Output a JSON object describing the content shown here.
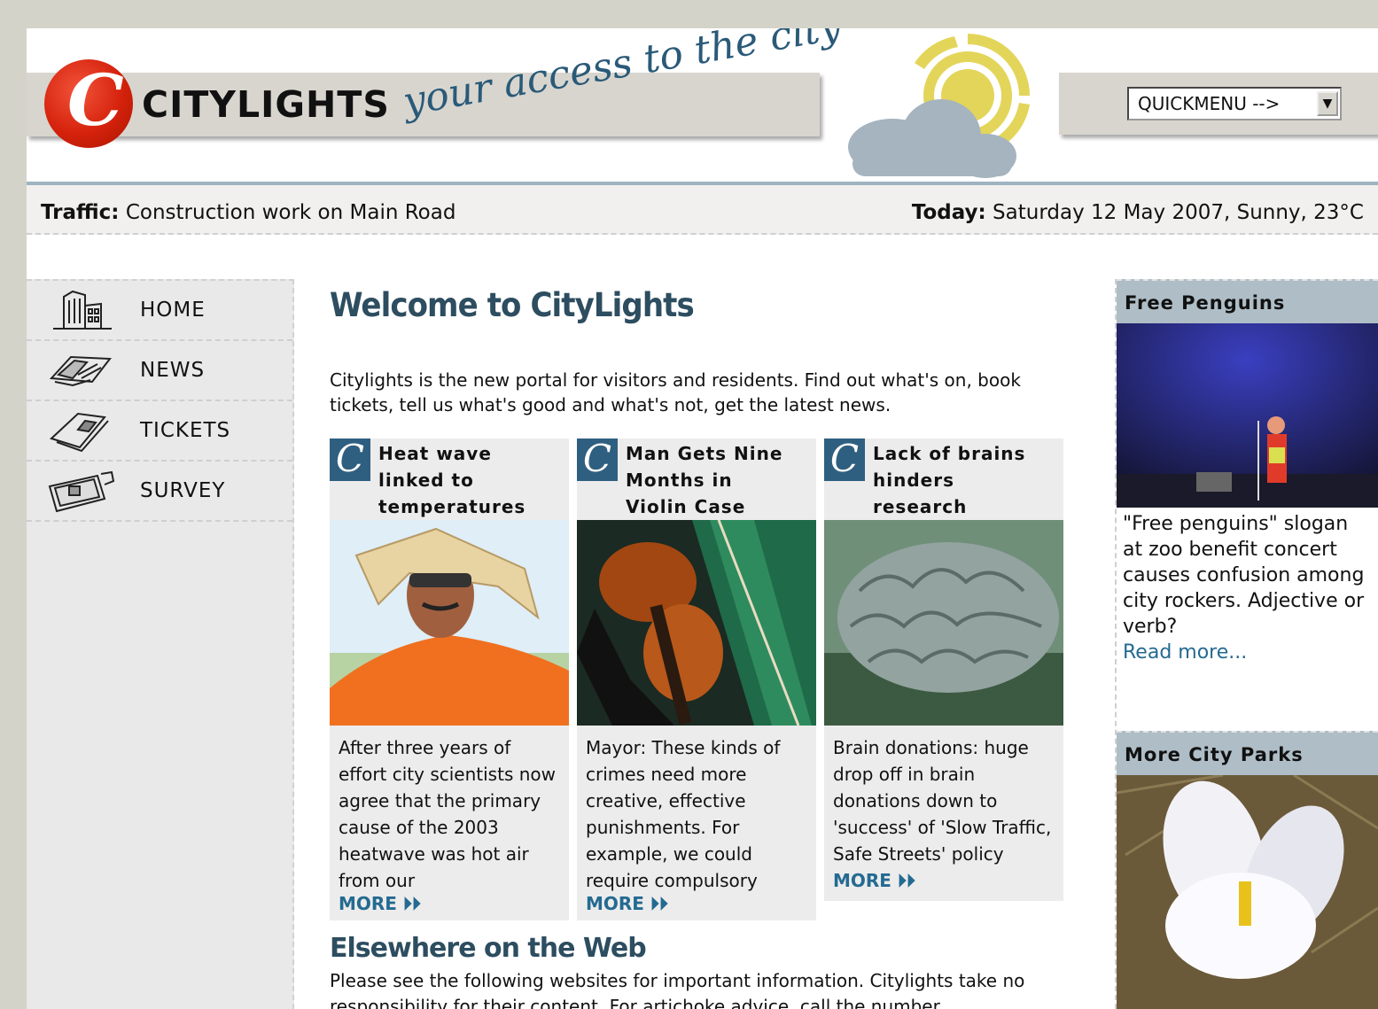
{
  "header": {
    "brand": "CITYLIGHTS",
    "tagline": "your access to the city",
    "quickmenu_value": "QUICKMENU -->",
    "quickmenu_arrow": "▼"
  },
  "info_bar": {
    "traffic_label": "Traffic:",
    "traffic_text": "Construction work on Main Road",
    "today_label": "Today:",
    "today_text": "Saturday 12 May 2007, Sunny, 23°C"
  },
  "nav": {
    "items": [
      {
        "label": "HOME",
        "icon": "building-icon"
      },
      {
        "label": "NEWS",
        "icon": "newspaper-icon"
      },
      {
        "label": "TICKETS",
        "icon": "ticket-icon"
      },
      {
        "label": "SURVEY",
        "icon": "clipboard-icon"
      }
    ]
  },
  "main": {
    "title": "Welcome to CityLights",
    "intro": "Citylights is the new portal for visitors and residents. Find out what's on, book tickets, tell us what's good and what's not, get the latest news.",
    "stories": [
      {
        "title_lines": [
          "Heat wave",
          "linked to",
          "temperatures"
        ],
        "body": "After three years of effort city scientists now agree that the primary cause of the 2003 heatwave was hot air from our",
        "more": "MORE ⏵⏵"
      },
      {
        "title_lines": [
          "Man Gets Nine",
          "Months in",
          "Violin Case"
        ],
        "body": "Mayor: These kinds of crimes need more creative, effective punishments. For example, we could require compulsory",
        "more": "MORE ⏵⏵"
      },
      {
        "title_lines": [
          "Lack of brains",
          "hinders",
          "research"
        ],
        "body": "Brain donations: huge drop off in brain donations down to 'success' of 'Slow Traffic, Safe Streets' policy",
        "more": "MORE ⏵⏵"
      }
    ],
    "elsewhere_title": "Elsewhere on the Web",
    "elsewhere_text": "Please see the following websites for important information. Citylights take no responsibility for their content. For artichoke advice, call the number"
  },
  "right": {
    "box1_title": "Free Penguins",
    "box1_text": "\"Free penguins\" slogan at zoo benefit concert causes confusion among city rockers. Adjective or verb?",
    "box1_link": "Read more...",
    "box2_title": "More City Parks"
  },
  "colors": {
    "accent_blue": "#2d4d60",
    "link_blue": "#246a91",
    "logo_red": "#d5220c",
    "sun_yellow": "#e3d55a",
    "cloud_grey": "#a5b4bf"
  }
}
